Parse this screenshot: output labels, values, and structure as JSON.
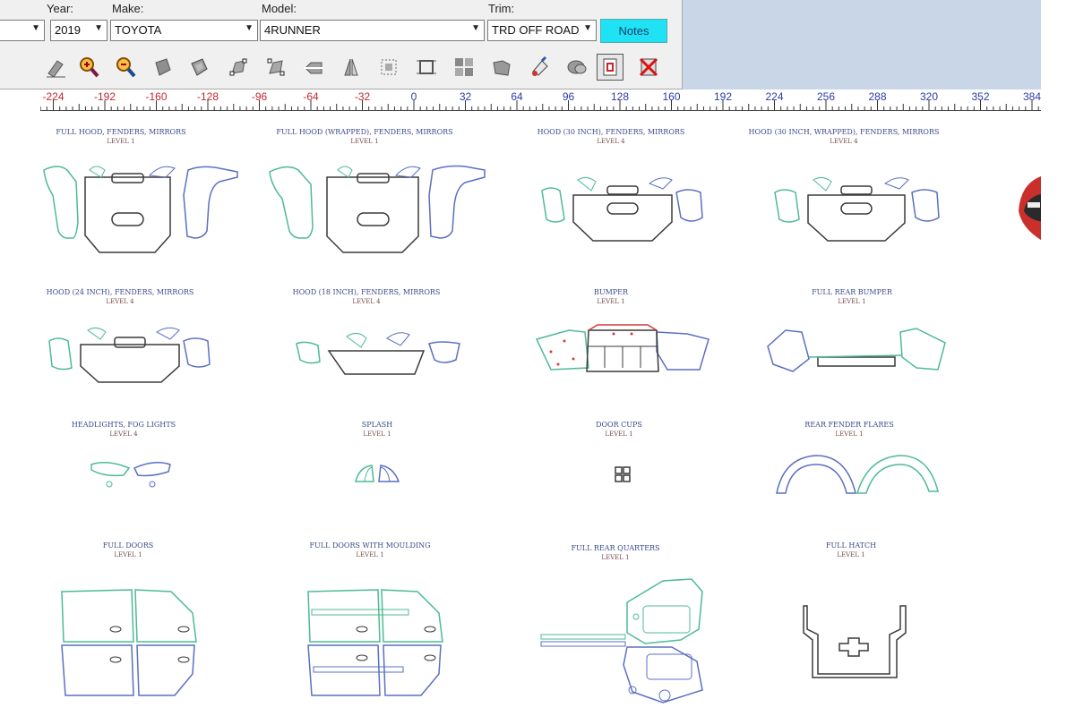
{
  "vehicle": {
    "year_label": "Year:",
    "year_value": "2019",
    "make_label": "Make:",
    "make_value": "TOYOTA",
    "model_label": "Model:",
    "model_value": "4RUNNER",
    "trim_label": "Trim:",
    "trim_value": "TRD OFF ROAD",
    "notes_label": "Notes"
  },
  "toolbar": {
    "tools": [
      "eraser-icon",
      "zoom-in-icon",
      "zoom-out-icon",
      "shape-fill-icon",
      "shape-outline-icon",
      "node-select-icon",
      "node-edit-icon",
      "flip-horizontal-icon",
      "mirror-icon",
      "bounding-box-icon",
      "crop-marks-icon",
      "nest-icon",
      "weld-icon",
      "paint-icon",
      "merge-icon",
      "frame-icon",
      "delete-cross-icon"
    ],
    "active_tool_index": 15
  },
  "ruler": {
    "labels": [
      "-224",
      "-192",
      "-160",
      "-128",
      "-96",
      "-64",
      "-32",
      "0",
      "32",
      "64",
      "96",
      "128",
      "160",
      "192",
      "224",
      "256",
      "288",
      "320",
      "352",
      "384"
    ]
  },
  "colors": {
    "pattern_green": "#4dbb93",
    "pattern_blue": "#5b6fc2",
    "pattern_dark": "#3a3a3a",
    "pattern_red": "#d43a3a",
    "notes_bg": "#1fe3f5"
  },
  "patterns": [
    {
      "title": "FULL HOOD, FENDERS, MIRRORS",
      "level": "LEVEL 1"
    },
    {
      "title": "FULL HOOD (WRAPPED), FENDERS, MIRRORS",
      "level": "LEVEL 1"
    },
    {
      "title": "HOOD (30 INCH), FENDERS, MIRRORS",
      "level": "LEVEL 4"
    },
    {
      "title": "HOOD (30 INCH, WRAPPED), FENDERS, MIRRORS",
      "level": "LEVEL 4"
    },
    {
      "title": "HOOD (24 INCH), FENDERS, MIRRORS",
      "level": "LEVEL 4"
    },
    {
      "title": "HOOD (18 INCH), FENDERS, MIRRORS",
      "level": "LEVEL 4"
    },
    {
      "title": "BUMPER",
      "level": "LEVEL 1"
    },
    {
      "title": "FULL REAR BUMPER",
      "level": "LEVEL 1"
    },
    {
      "title": "HEADLIGHTS, FOG LIGHTS",
      "level": "LEVEL 4"
    },
    {
      "title": "SPLASH",
      "level": "LEVEL 1"
    },
    {
      "title": "DOOR CUPS",
      "level": "LEVEL 1"
    },
    {
      "title": "REAR FENDER FLARES",
      "level": "LEVEL 1"
    },
    {
      "title": "FULL DOORS",
      "level": "LEVEL 1"
    },
    {
      "title": "FULL DOORS WITH MOULDING",
      "level": "LEVEL 1"
    },
    {
      "title": "FULL REAR QUARTERS",
      "level": "LEVEL 1"
    },
    {
      "title": "FULL HATCH",
      "level": "LEVEL 1"
    }
  ]
}
